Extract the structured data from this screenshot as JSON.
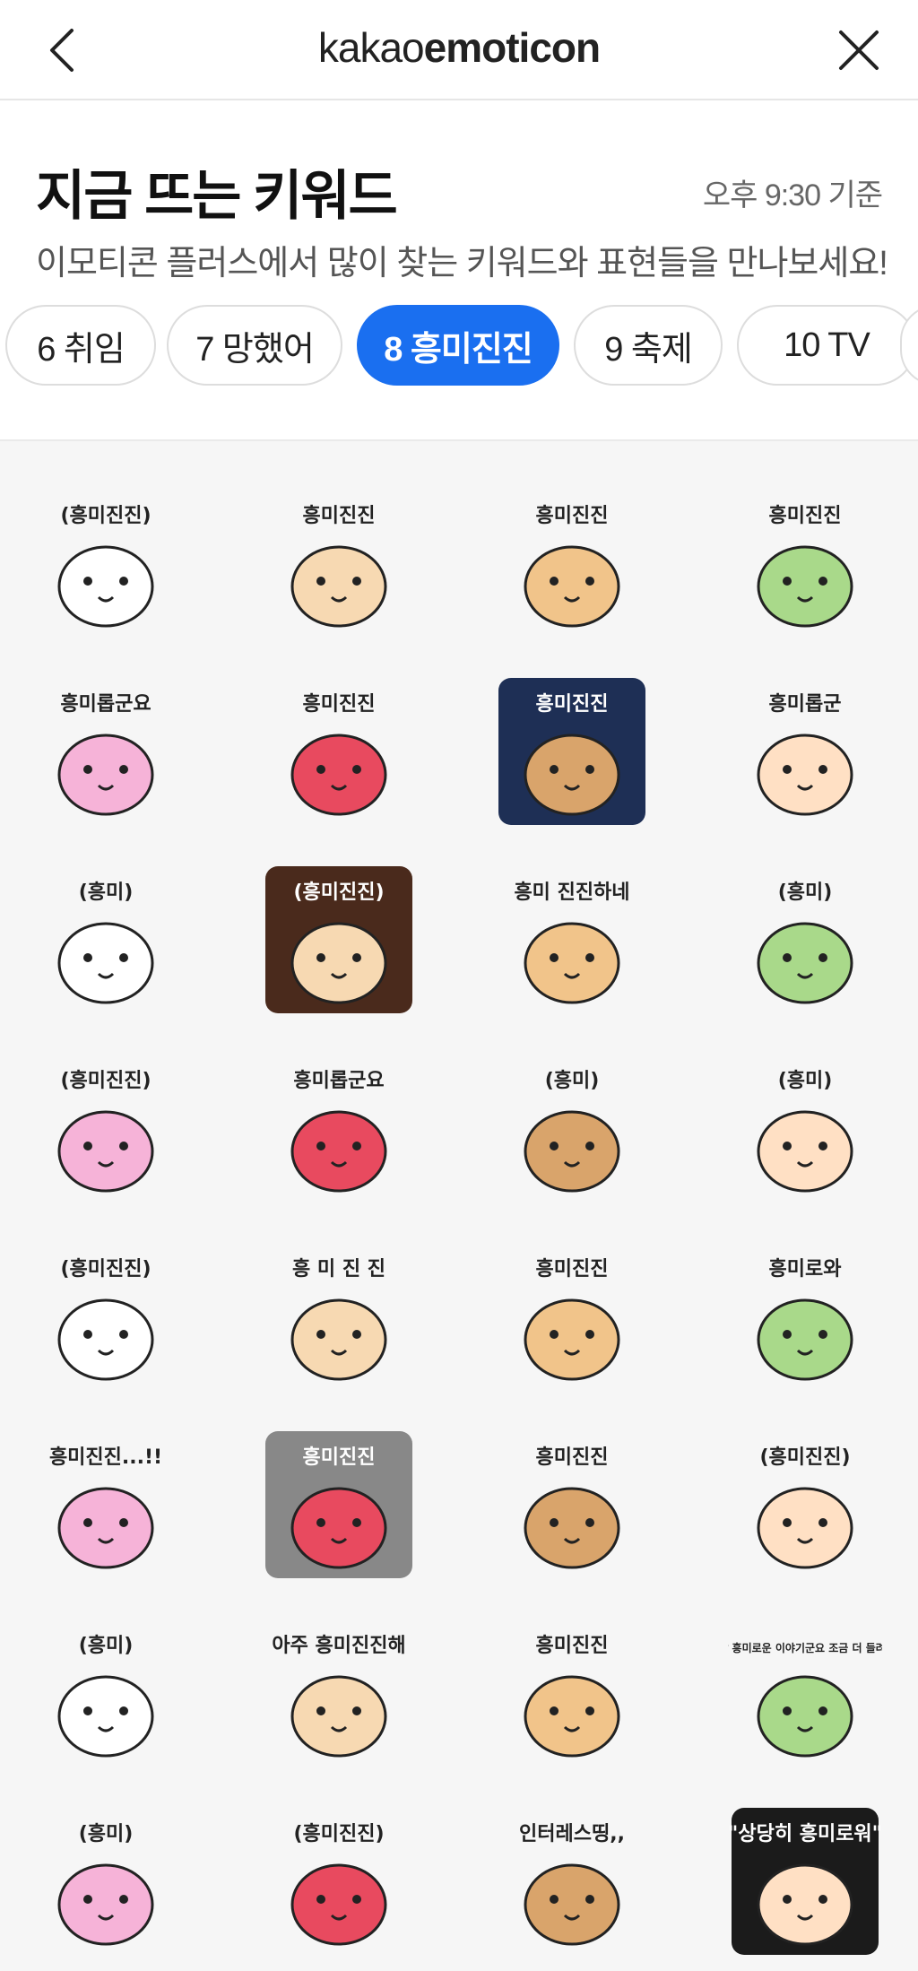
{
  "header": {
    "brand_light": "kakao",
    "brand_bold": "emoticon",
    "back_icon": "chevron-left-icon",
    "close_icon": "close-icon"
  },
  "section": {
    "title": "지금 뜨는 키워드",
    "time": "오후 9:30 기준",
    "subtitle": "이모티콘 플러스에서 많이 찾는 키워드와 표현들을 만나보세요!"
  },
  "chips": [
    {
      "label": "6 취임",
      "active": false
    },
    {
      "label": "7 망했어",
      "active": false
    },
    {
      "label": "8 흥미진진",
      "active": true
    },
    {
      "label": "9 축제",
      "active": false
    },
    {
      "label": "10 TV",
      "active": false
    }
  ],
  "colors": {
    "accent": "#1a6ff0",
    "grid_bg": "#f6f6f6"
  },
  "stickers": [
    {
      "caption": "(흥미진진)",
      "bg": "#fff"
    },
    {
      "caption": "흥미진진",
      "bg": "#fff"
    },
    {
      "caption": "흥미진진",
      "bg": "#fff"
    },
    {
      "caption": "흥미진진",
      "bg": "#fff"
    },
    {
      "caption": "흥미롭군요",
      "bg": "#fff"
    },
    {
      "caption": "흥미진진",
      "bg": "#fff"
    },
    {
      "caption": "흥미진진",
      "bg": "#1e2f55"
    },
    {
      "caption": "흥미롭군",
      "bg": "#fff"
    },
    {
      "caption": "(흥미)",
      "bg": "#fff"
    },
    {
      "caption": "(흥미진진)",
      "bg": "#4a2a1c"
    },
    {
      "caption": "흥미 진진하네",
      "bg": "#fff"
    },
    {
      "caption": "(흥미)",
      "bg": "#fff"
    },
    {
      "caption": "(흥미진진)",
      "bg": "#fff"
    },
    {
      "caption": "흥미롭군요",
      "bg": "#fff"
    },
    {
      "caption": "(흥미)",
      "bg": "#fff"
    },
    {
      "caption": "(흥미)",
      "bg": "#fff"
    },
    {
      "caption": "(흥미진진)",
      "bg": "#fff"
    },
    {
      "caption": "흥 미 진 진",
      "bg": "#fff"
    },
    {
      "caption": "흥미진진",
      "bg": "#fff"
    },
    {
      "caption": "흥미로와",
      "bg": "#fff"
    },
    {
      "caption": "흥미진진...!!",
      "bg": "#fff"
    },
    {
      "caption": "흥미진진",
      "bg": "#888"
    },
    {
      "caption": "흥미진진",
      "bg": "#fff"
    },
    {
      "caption": "(흥미진진)",
      "bg": "#fff"
    },
    {
      "caption": "(흥미)",
      "bg": "#fff"
    },
    {
      "caption": "아주 흥미진진해",
      "bg": "#fff"
    },
    {
      "caption": "흥미진진",
      "bg": "#fff"
    },
    {
      "caption": "그것 참 흥미로운 이야기군요 조금 더 들려주시죠",
      "bg": "#fff"
    },
    {
      "caption": "(흥미)",
      "bg": "#fff"
    },
    {
      "caption": "(흥미진진)",
      "bg": "#fff"
    },
    {
      "caption": "인터레스띵,,",
      "bg": "#fff"
    },
    {
      "caption": "\"상당히 흥미로워\"",
      "bg": "#1b1b1b"
    }
  ]
}
